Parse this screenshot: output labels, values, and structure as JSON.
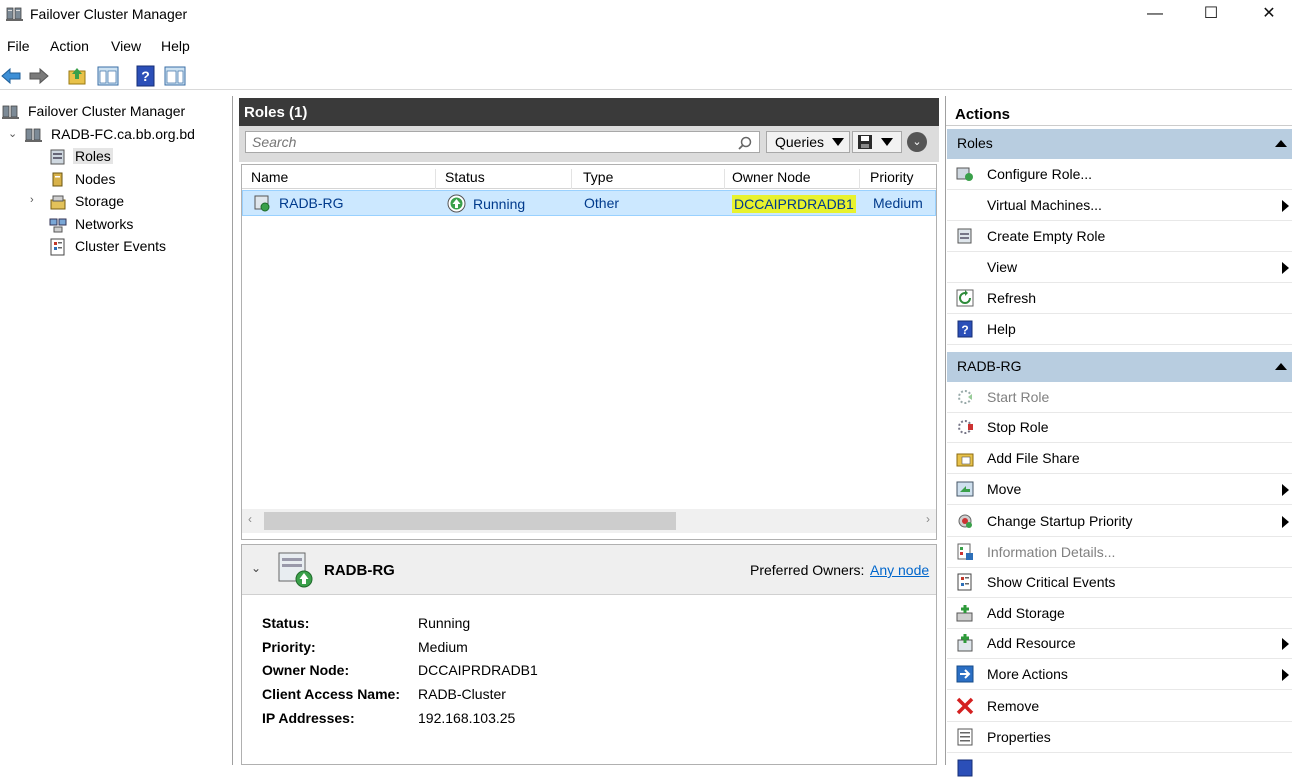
{
  "window": {
    "title": "Failover Cluster Manager"
  },
  "menu": [
    "File",
    "Action",
    "View",
    "Help"
  ],
  "tree": {
    "root": "Failover Cluster Manager",
    "cluster": "RADB-FC.ca.bb.org.bd",
    "items": [
      "Roles",
      "Nodes",
      "Storage",
      "Networks",
      "Cluster Events"
    ],
    "selected": "Roles"
  },
  "roles_pane": {
    "header": "Roles (1)",
    "search_placeholder": "Search",
    "queries_label": "Queries",
    "columns": [
      "Name",
      "Status",
      "Type",
      "Owner Node",
      "Priority"
    ],
    "rows": [
      {
        "name": "RADB-RG",
        "status": "Running",
        "type": "Other",
        "owner": "DCCAIPRDRADB1",
        "priority": "Medium"
      }
    ]
  },
  "details": {
    "name": "RADB-RG",
    "preferred_owners_label": "Preferred Owners:",
    "preferred_owners_value": "Any node",
    "fields": [
      {
        "label": "Status:",
        "value": "Running"
      },
      {
        "label": "Priority:",
        "value": "Medium"
      },
      {
        "label": "Owner Node:",
        "value": "DCCAIPRDRADB1"
      },
      {
        "label": "Client Access Name:",
        "value": "RADB-Cluster"
      },
      {
        "label": "IP Addresses:",
        "value": "192.168.103.25"
      }
    ]
  },
  "actions": {
    "title": "Actions",
    "roles_section": "Roles",
    "roles_actions": [
      {
        "label": "Configure Role...",
        "icon": "configure-role-icon"
      },
      {
        "label": "Virtual Machines...",
        "submenu": true
      },
      {
        "label": "Create Empty Role",
        "icon": "create-role-icon"
      },
      {
        "label": "View",
        "submenu": true
      },
      {
        "label": "Refresh",
        "icon": "refresh-icon"
      },
      {
        "label": "Help",
        "icon": "help-icon"
      }
    ],
    "rg_section": "RADB-RG",
    "rg_actions": [
      {
        "label": "Start Role",
        "icon": "start-role-icon",
        "disabled": true
      },
      {
        "label": "Stop Role",
        "icon": "stop-role-icon"
      },
      {
        "label": "Add File Share",
        "icon": "file-share-icon"
      },
      {
        "label": "Move",
        "icon": "move-icon",
        "submenu": true
      },
      {
        "label": "Change Startup Priority",
        "icon": "priority-icon",
        "submenu": true
      },
      {
        "label": "Information Details...",
        "icon": "info-icon",
        "disabled": true
      },
      {
        "label": "Show Critical Events",
        "icon": "events-icon"
      },
      {
        "label": "Add Storage",
        "icon": "add-storage-icon"
      },
      {
        "label": "Add Resource",
        "icon": "add-resource-icon",
        "submenu": true
      },
      {
        "label": "More Actions",
        "icon": "more-actions-icon",
        "submenu": true
      },
      {
        "label": "Remove",
        "icon": "remove-icon"
      },
      {
        "label": "Properties",
        "icon": "properties-icon"
      }
    ]
  },
  "colors": {
    "selection": "#cce8ff",
    "section_header": "#b8cde0",
    "link": "#0066cc",
    "highlight": "#e8f22e"
  }
}
